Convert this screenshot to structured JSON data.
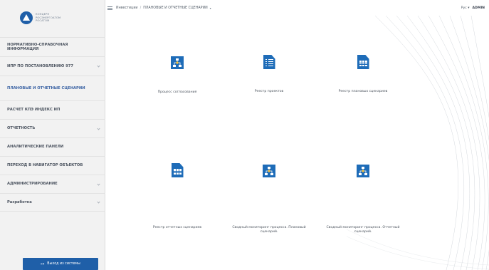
{
  "logo": {
    "lines": [
      "КОНЦЕРН",
      "РОСЭНЕРГОАТОМ",
      "РОСАТОМ"
    ],
    "icon": "rosatom-logo-icon"
  },
  "sidebar": {
    "items": [
      {
        "label": "НОРМАТИВНО-СПРАВОЧНАЯ ИНФОРМАЦИЯ",
        "has_chevron": false
      },
      {
        "label": "ИПР ПО ПОСТАНОВЛЕНИЮ 977",
        "has_chevron": true
      },
      {
        "label": "ПЛАНОВЫЕ И ОТЧЕТНЫЕ СЦЕНАРИИ",
        "has_chevron": false,
        "active": true
      },
      {
        "label": "РАСЧЕТ КПЭ ИНДЕКС ИП",
        "has_chevron": false
      },
      {
        "label": "ОТЧЕТНОСТЬ",
        "has_chevron": true
      },
      {
        "label": "АНАЛИТИЧЕСКИЕ ПАНЕЛИ",
        "has_chevron": false
      },
      {
        "label": "ПЕРЕХОД В НАВИГАТОР ОБЪЕКТОВ",
        "has_chevron": false
      },
      {
        "label": "АДМИНИСТРИРОВАНИЕ",
        "has_chevron": true
      },
      {
        "label": "Разработка",
        "has_chevron": true
      }
    ],
    "logout_label": "Выход из системы",
    "logout_icon": "logout-icon"
  },
  "topbar": {
    "breadcrumb_root": "Инвестиции",
    "breadcrumb_sep": "/",
    "breadcrumb_current": "ПЛАНОВЫЕ И ОТЧЕТНЫЕ СЦЕНАРИИ",
    "breadcrumb_caret": "▾",
    "lang": "Рус",
    "lang_caret": "▾",
    "user": "ADMIN"
  },
  "tiles": [
    {
      "label": "Процесс согласования",
      "icon": "flowchart-icon"
    },
    {
      "label": "Реестр проектов",
      "icon": "checklist-document-icon"
    },
    {
      "label": "Реестр плановых сценариев",
      "icon": "table-document-icon"
    },
    {
      "label": "Реестр отчетных сценариев",
      "icon": "table-document-icon"
    },
    {
      "label": "Сводный мониторинг процесса. Плановый сценарий.",
      "icon": "flowchart-icon"
    },
    {
      "label": "Сводный мониторинг процесса. Отчетный сценарий.",
      "icon": "flowchart-icon"
    }
  ],
  "colors": {
    "accent": "#1e6cb8",
    "sidebar_bg": "#f2f2f2",
    "active_nav": "#3b63a4"
  }
}
